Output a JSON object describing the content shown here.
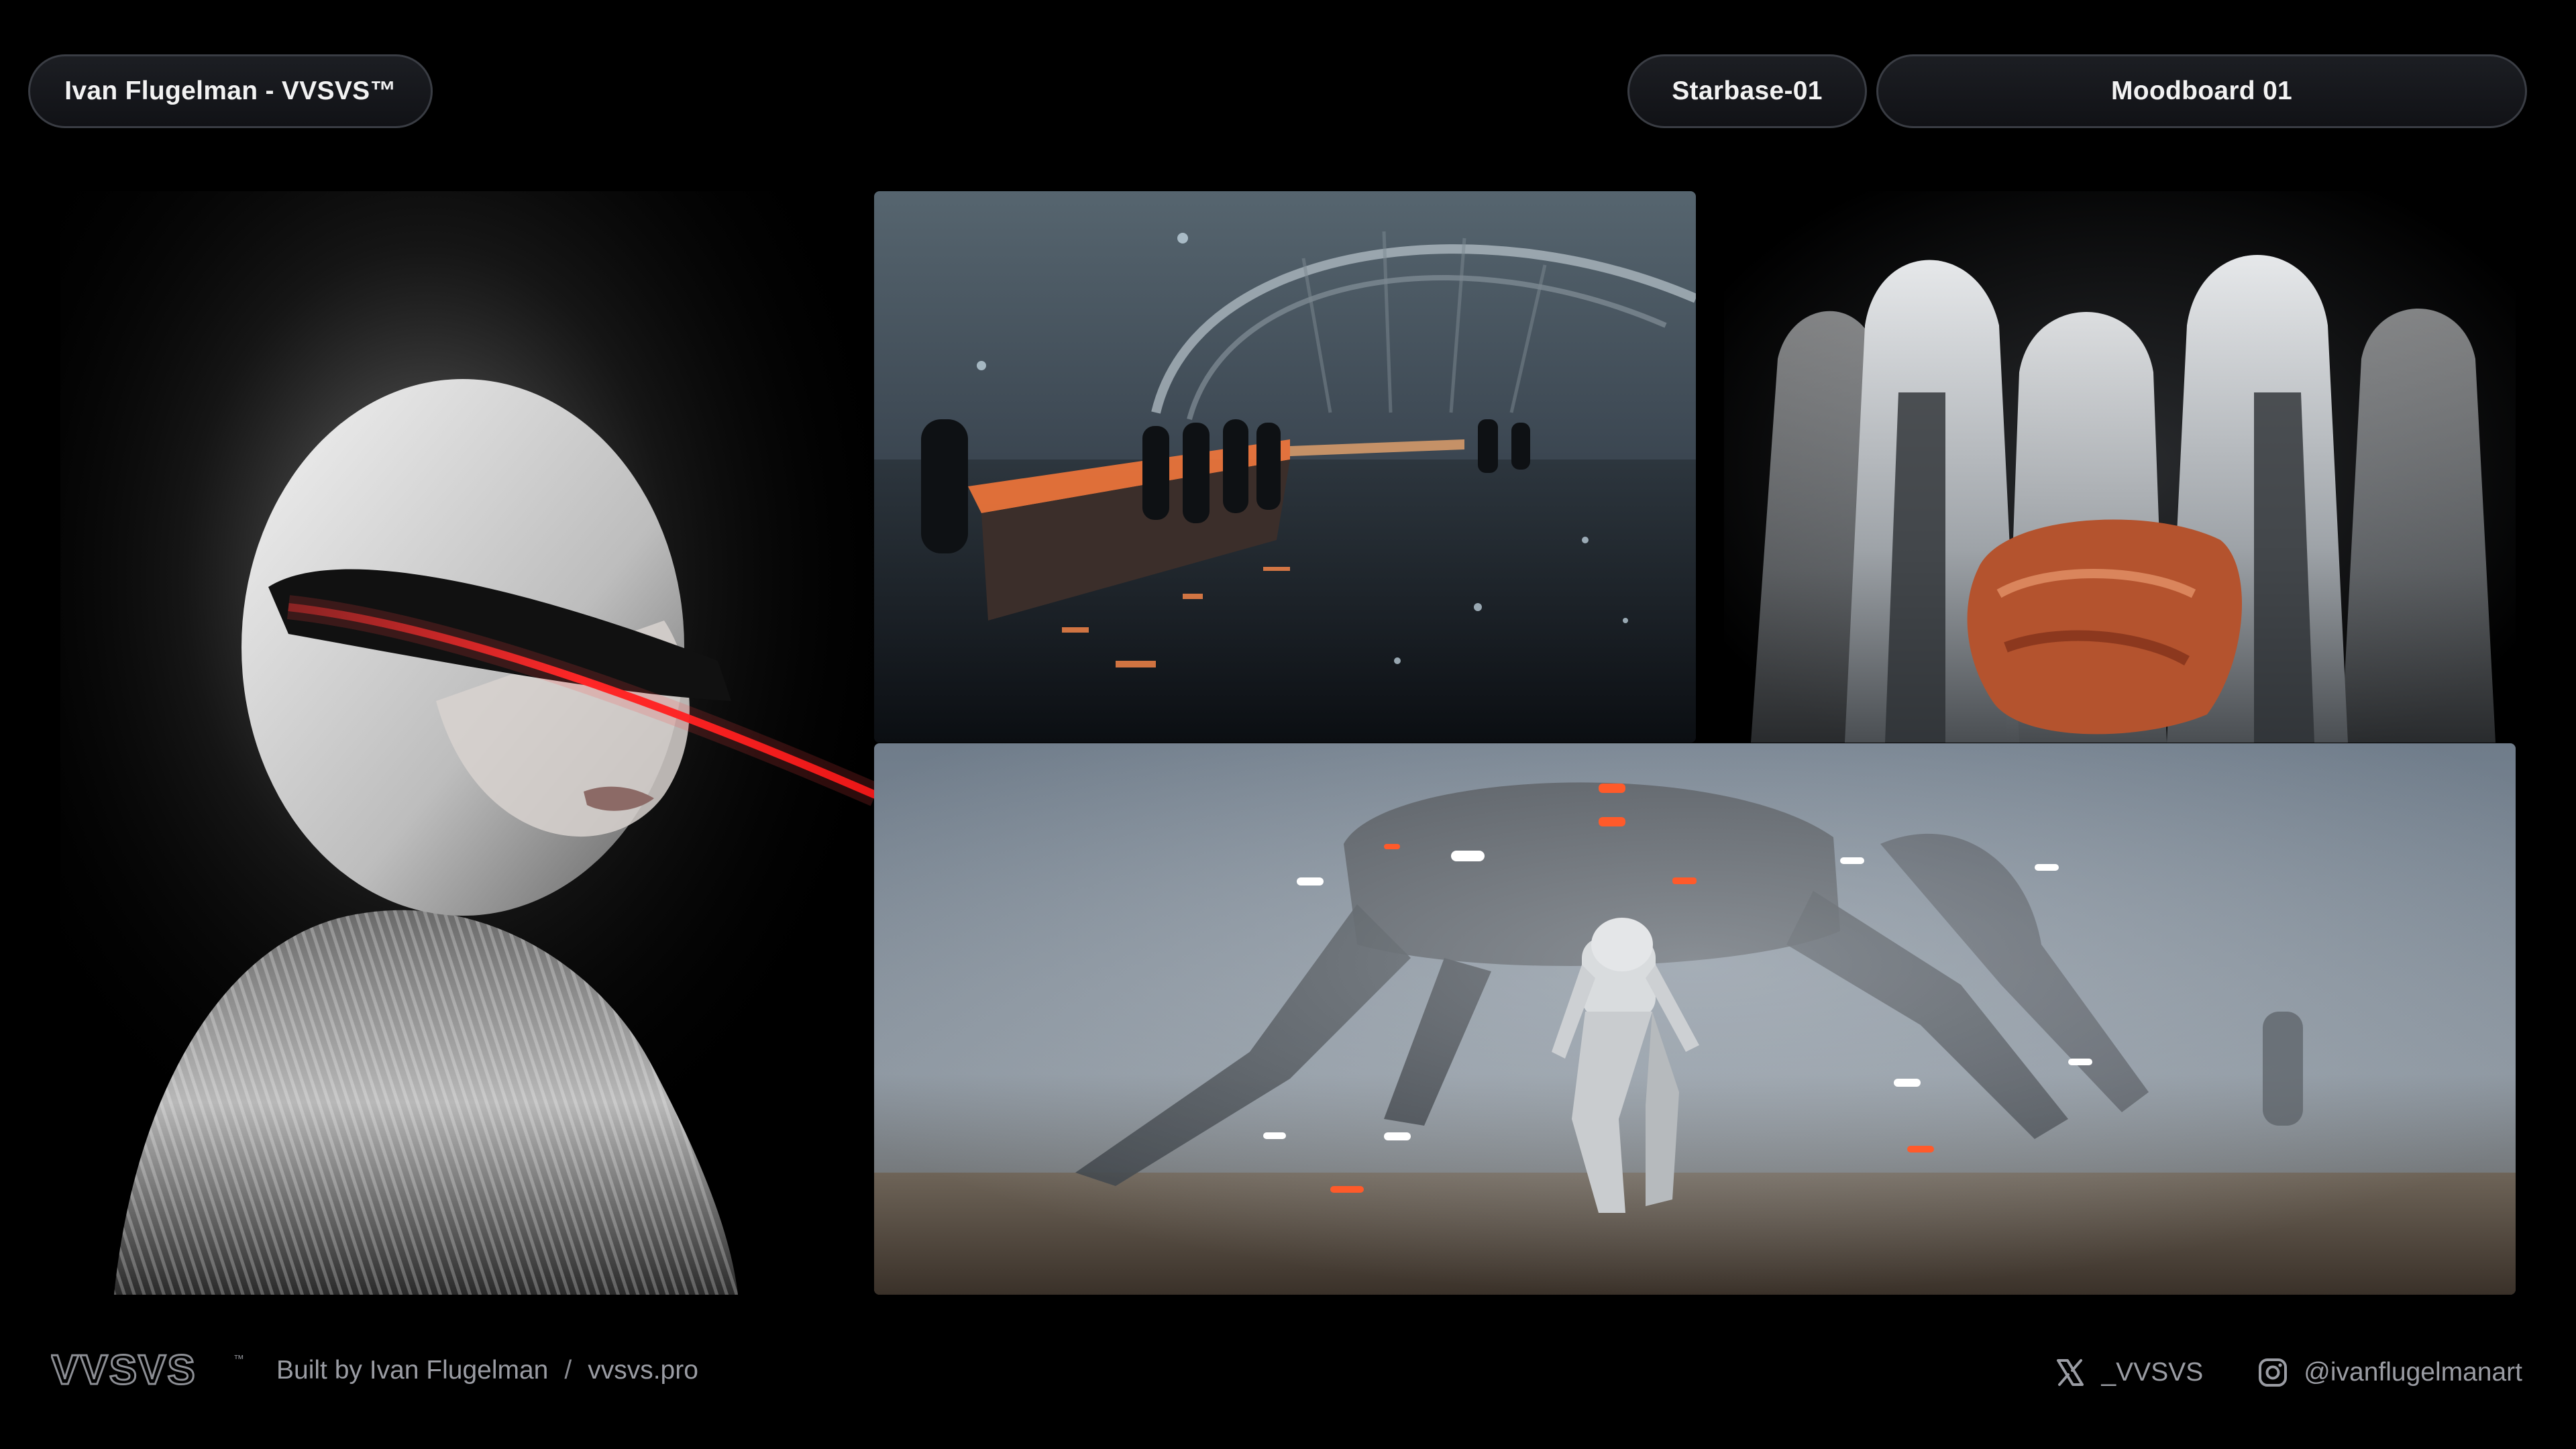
{
  "header": {
    "author_pill": "Ivan Flugelman - VVSVS™",
    "project_pill": "Starbase-01",
    "moodboard_pill": "Moodboard 01"
  },
  "footer": {
    "logo_text": "VVSVS",
    "logo_tm": "™",
    "built_by": "Built by Ivan Flugelman",
    "separator": "/",
    "site": "vvsvs.pro",
    "x_handle": "_VVSVS",
    "instagram_handle": "@ivanflugelmanart"
  },
  "icons": {
    "x": "x-logo-icon",
    "instagram": "instagram-icon"
  },
  "colors": {
    "background": "#000000",
    "pill_border": "#3a3d44",
    "footer_text": "#9a9ca3",
    "accent_red": "#ff2a2a"
  }
}
